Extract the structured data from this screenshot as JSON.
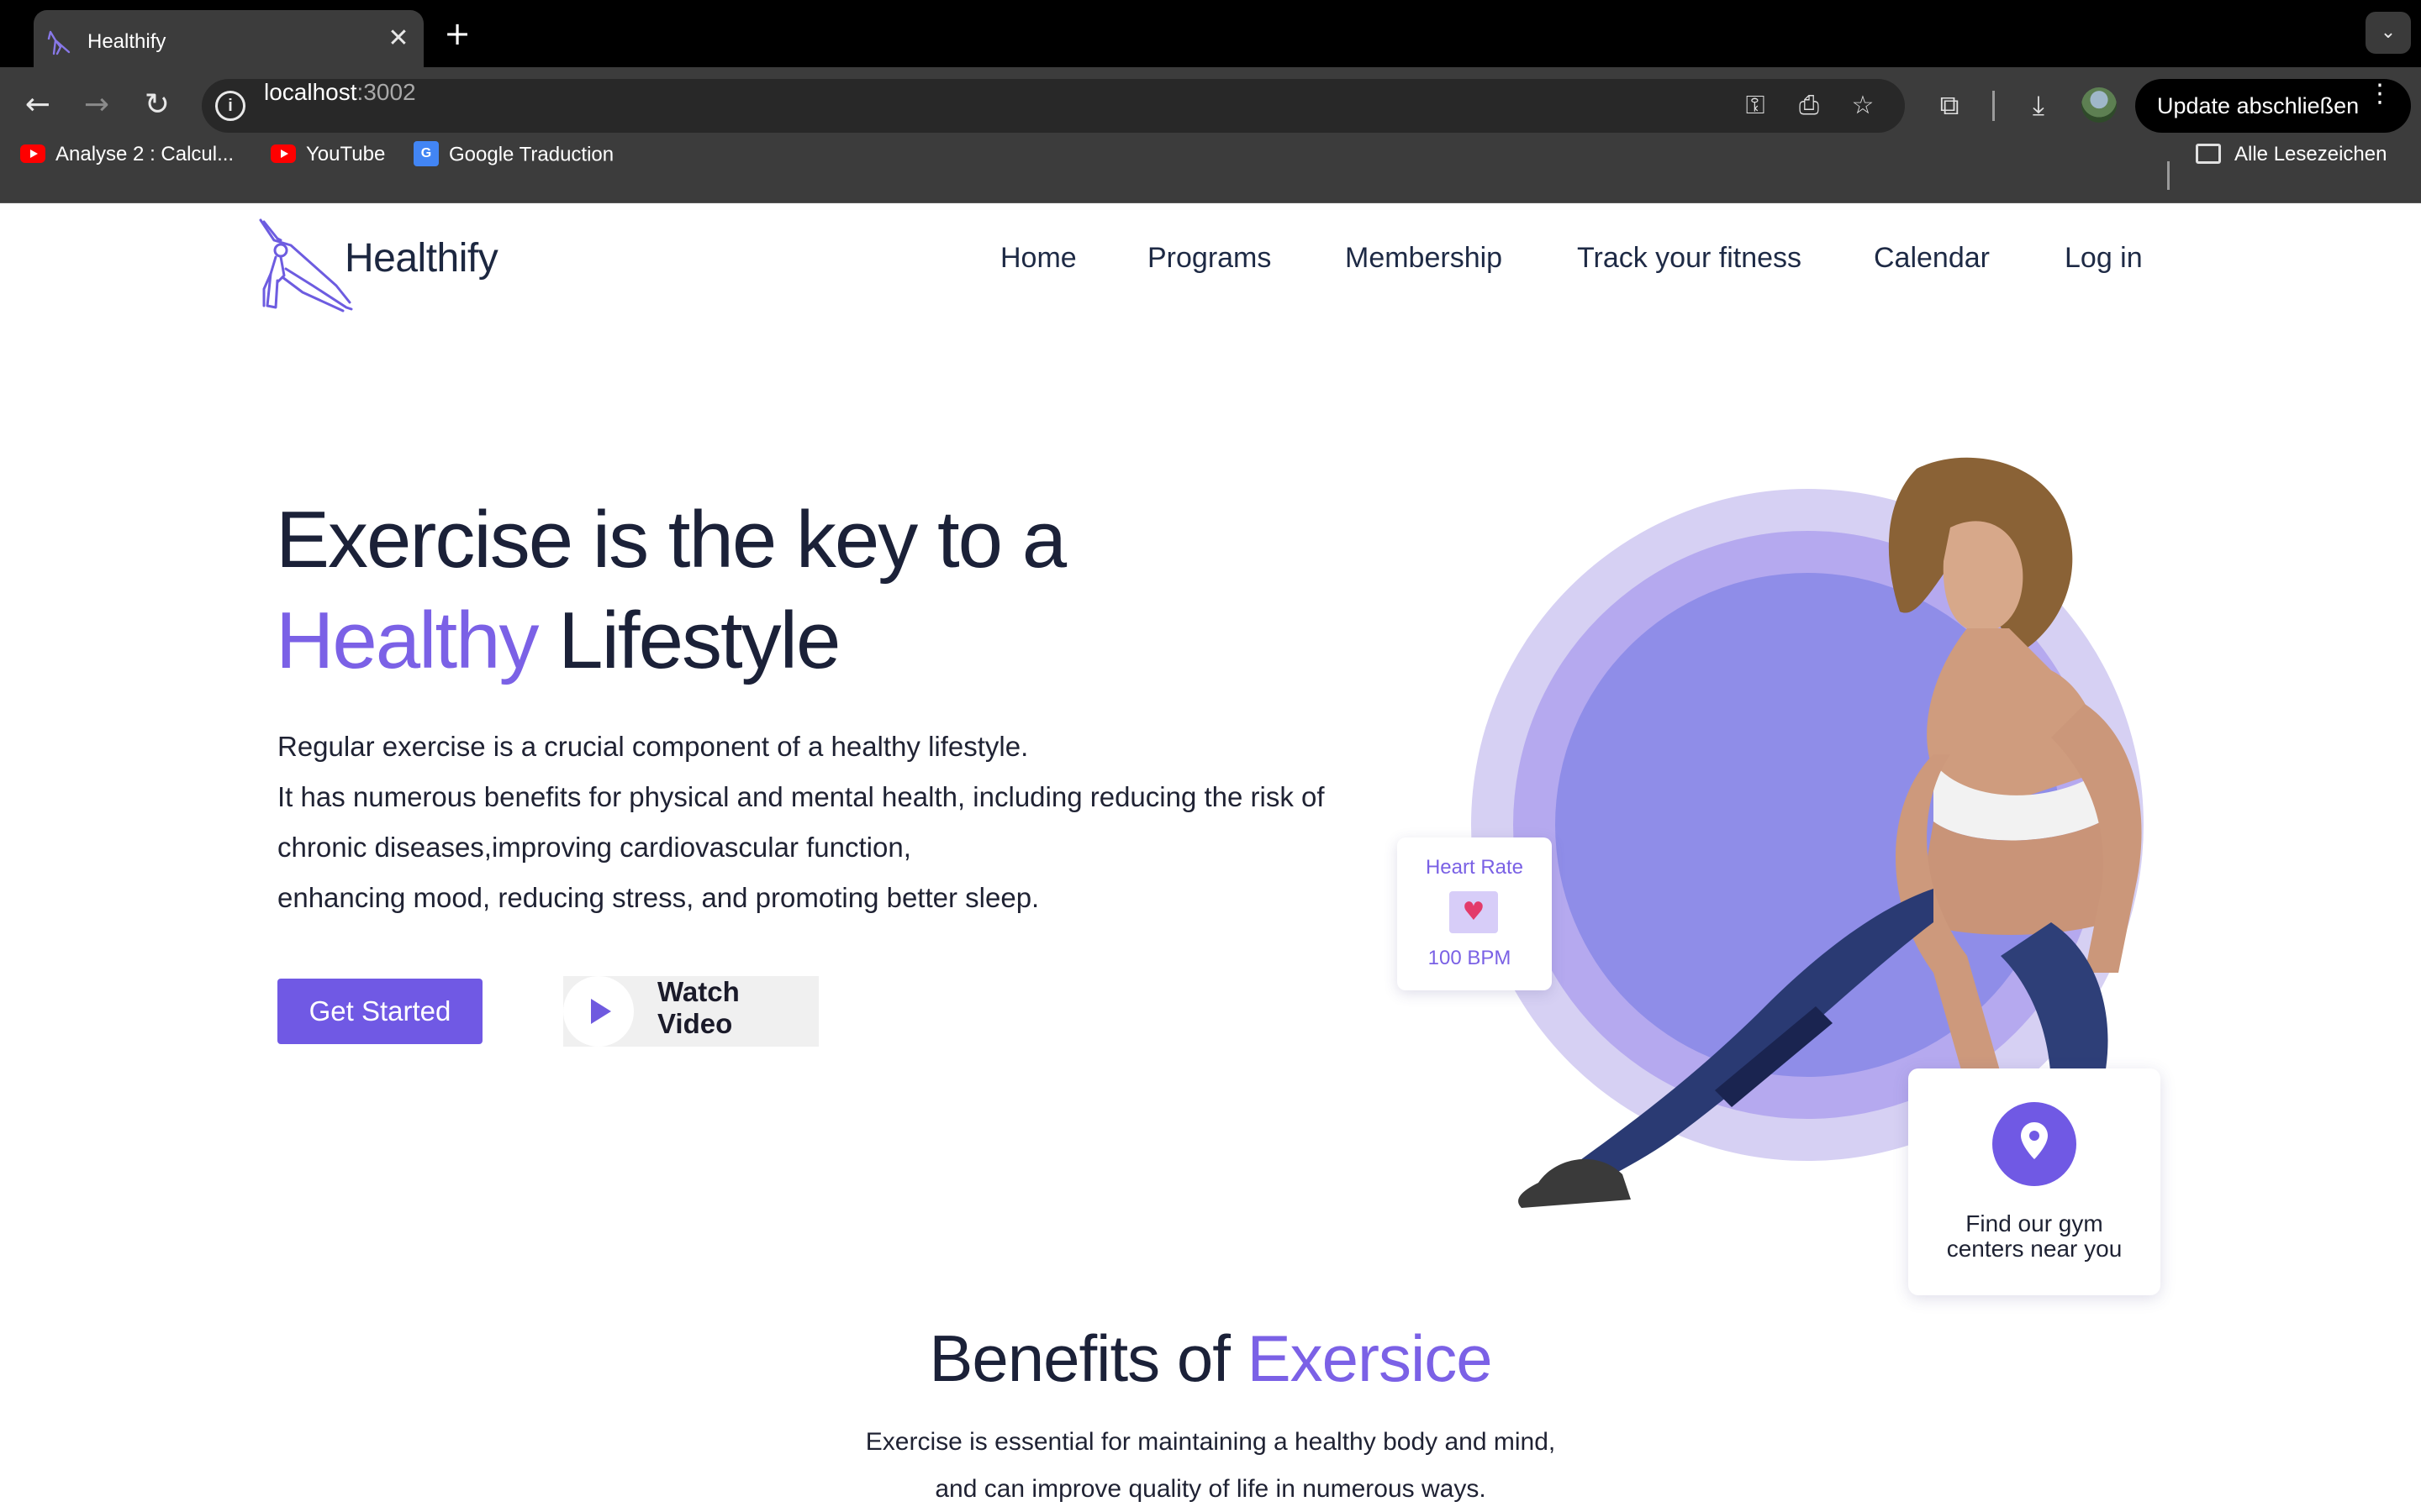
{
  "browser": {
    "tab_title": "Healthify",
    "tab_close": "✕",
    "new_tab": "+",
    "url_host": "localhost",
    "url_port": ":3002",
    "update_label": "Update abschließen",
    "bookmarks": [
      {
        "label": "Analyse 2 : Calcul...",
        "icon": "youtube-icon"
      },
      {
        "label": "YouTube",
        "icon": "youtube-icon"
      },
      {
        "label": "Google Traduction",
        "icon": "google-translate-icon"
      }
    ],
    "all_bookmarks": "Alle Lesezeichen"
  },
  "site": {
    "brand": "Healthify",
    "nav": [
      "Home",
      "Programs",
      "Membership",
      "Track your fitness",
      "Calendar",
      "Log in"
    ],
    "hero": {
      "title_line1": "Exercise is the key to a",
      "title_accent": "Healthy",
      "title_line2_rest": " Lifestyle",
      "paragraph": [
        "Regular exercise is a crucial component of a healthy lifestyle.",
        "It has numerous benefits for physical and mental health, including reducing the risk of",
        "chronic diseases,improving cardiovascular function,",
        "enhancing mood, reducing stress, and promoting better sleep."
      ],
      "cta_primary": "Get Started",
      "cta_secondary": "Watch Video"
    },
    "heart_card": {
      "label": "Heart Rate",
      "value": "100 BPM"
    },
    "gym_card": {
      "line1": "Find our gym",
      "line2": "centers near you"
    },
    "benefits": {
      "title": "Benefits of ",
      "title_accent": "Exersice",
      "line1": "Exercise is essential for maintaining a healthy body and mind,",
      "line2": "and can improve quality of life in numerous ways."
    }
  },
  "colors": {
    "accent": "#7b61e6",
    "button": "#7059e4",
    "heading": "#1b2138",
    "browser_dark": "#3c3c3c"
  }
}
